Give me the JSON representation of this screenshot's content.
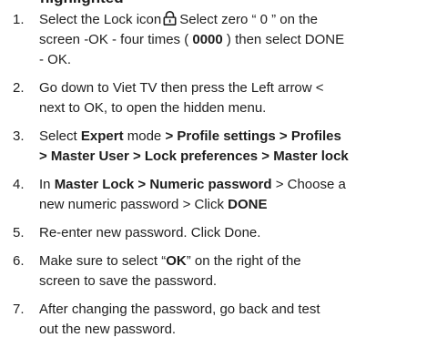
{
  "heading_partial": "highlighted",
  "lock_icon": "lock-icon",
  "steps": [
    {
      "number": "1.",
      "l1_a": "Select the Lock icon",
      "l1_b": "Select zero “ 0 ” on the",
      "l2_a": "screen -OK - four times (",
      "l2_b": "0000",
      "l2_c": ") then select DONE",
      "l3": "- OK."
    },
    {
      "number": "2.",
      "l1": "Go down to Viet TV then press the Left arrow <",
      "l2": "next to OK, to open the hidden menu."
    },
    {
      "number": "3.",
      "l1_a": "Select",
      "l1_b": "Expert",
      "l1_c": "mode",
      "l1_d": "> Profile settings > Profiles",
      "l2": "> Master User > Lock preferences > Master lock"
    },
    {
      "number": "4.",
      "l1_a": "In",
      "l1_b": "Master Lock > Numeric password",
      "l1_c": "> Choose a",
      "l2_a": "new numeric password  > Click",
      "l2_b": "DONE"
    },
    {
      "number": "5.",
      "l1": "Re-enter new password. Click Done."
    },
    {
      "number": "6.",
      "l1_a": "Make sure to select “",
      "l1_b": "OK",
      "l1_c": "” on the right of the",
      "l2": "screen to save the password."
    },
    {
      "number": "7.",
      "l1": "After changing the password, go back and test",
      "l2": "out the new password."
    }
  ]
}
